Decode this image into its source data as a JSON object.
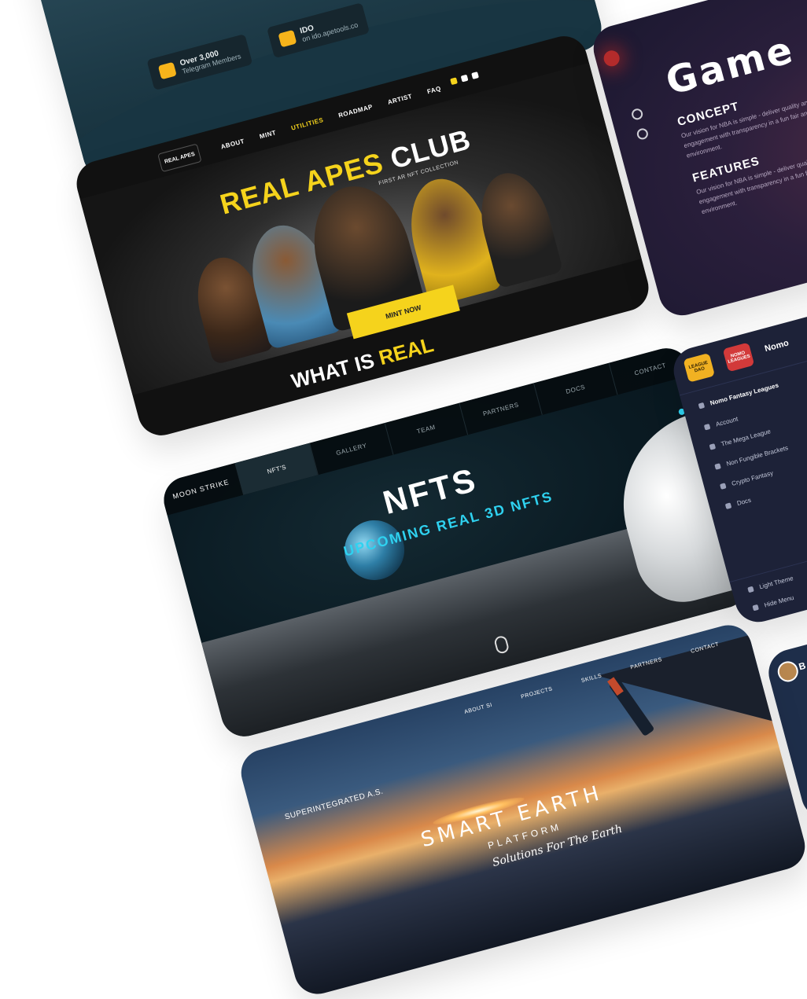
{
  "card_telegram": {
    "telegram_title": "Over 3,000",
    "telegram_sub": "Telegram Members",
    "ido_title": "IDO",
    "ido_sub": "on ido.apetools.co"
  },
  "card_apes": {
    "logo": "REAL APES",
    "nav": [
      "ABOUT",
      "MINT",
      "UTILITIES",
      "ROADMAP",
      "ARTIST",
      "FAQ"
    ],
    "title_yellow": "REAL APES",
    "title_white": "CLUB",
    "tagline": "FIRST AR NFT COLLECTION",
    "mint_button": "MINT NOW",
    "section_white": "WHAT IS",
    "section_yellow": "REAL"
  },
  "card_game": {
    "title": "Game",
    "concept_heading": "CONCEPT",
    "concept_text": "Our vision for NBA is simple - deliver quality and community engagement with transparency in a fun fair and competitive environment.",
    "features_heading": "FEATURES",
    "features_text": "Our vision for NBA is simple - deliver quality and community engagement with transparency in a fun fair and competitive environment."
  },
  "card_moonstrike": {
    "logo": "MOON STRIKE",
    "tabs": [
      "NFT'S",
      "GALLERY",
      "TEAM",
      "PARTNERS",
      "DOCS",
      "CONTACT"
    ],
    "active_tab": "NFT'S",
    "title": "NFTS",
    "subtitle": "UPCOMING REAL 3D NFTS"
  },
  "card_nomo": {
    "badge_left": "LEAGUE DAO",
    "badge_right": "NOMO LEAGUES",
    "header_name": "Nomo",
    "menu": [
      "Nomo Fantasy Leagues",
      "Account",
      "The Mega League",
      "Non Fungible Brackets",
      "Crypto Fantasy",
      "Docs"
    ],
    "light_theme": "Light Theme",
    "hide_menu": "Hide Menu"
  },
  "card_small": {
    "letter": "B"
  },
  "card_smartearth": {
    "nav": [
      "ABOUT SI",
      "PROJECTS",
      "SKILLS",
      "PARTNERS",
      "CONTACT"
    ],
    "brand": "SUPERINTEGRATED A.S.",
    "title": "SMART EARTH",
    "subtitle": "PLATFORM",
    "tagline": "Solutions For The Earth"
  },
  "colors": {
    "apes_yellow": "#f5d31c",
    "moon_cyan": "#2fd2f0",
    "nomo_gold": "#f1b122"
  }
}
